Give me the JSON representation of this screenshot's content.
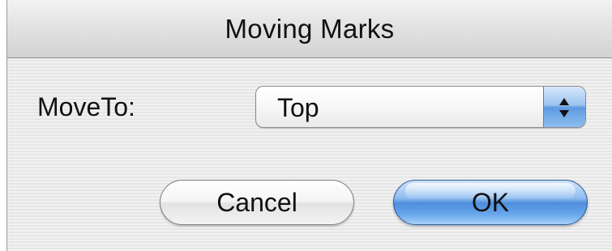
{
  "window": {
    "title": "Moving Marks"
  },
  "form": {
    "move_to_label": "MoveTo:",
    "move_to_value": "Top",
    "popup_icon": "updown-arrows-icon"
  },
  "buttons": {
    "cancel_label": "Cancel",
    "ok_label": "OK"
  },
  "colors": {
    "default_button_accent": "#4d8ddd",
    "popup_arrow_accent": "#5e9ae0"
  }
}
